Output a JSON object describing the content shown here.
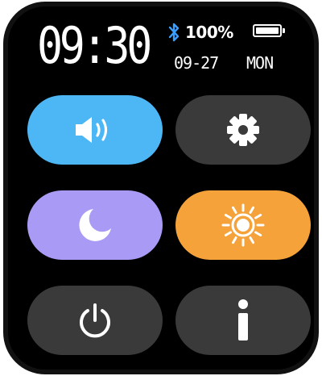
{
  "status": {
    "time": "09:30",
    "battery_percent": "100%",
    "battery_level": 1.0,
    "date": "09-27",
    "weekday": "MON",
    "bluetooth_icon": "bluetooth-icon"
  },
  "colors": {
    "sound_active": "#4db6f4",
    "settings_idle": "#3a3a3a",
    "dnd_active": "#a99bf5",
    "brightness_active": "#f5a23a",
    "power_idle": "#3a3a3a",
    "info_idle": "#3a3a3a",
    "bluetooth": "#3aa0ff"
  },
  "tiles": [
    {
      "name": "sound",
      "icon": "speaker-icon"
    },
    {
      "name": "settings",
      "icon": "gear-icon"
    },
    {
      "name": "do-not-disturb",
      "icon": "moon-icon"
    },
    {
      "name": "brightness",
      "icon": "sun-icon"
    },
    {
      "name": "power",
      "icon": "power-icon"
    },
    {
      "name": "info",
      "icon": "info-icon"
    }
  ]
}
